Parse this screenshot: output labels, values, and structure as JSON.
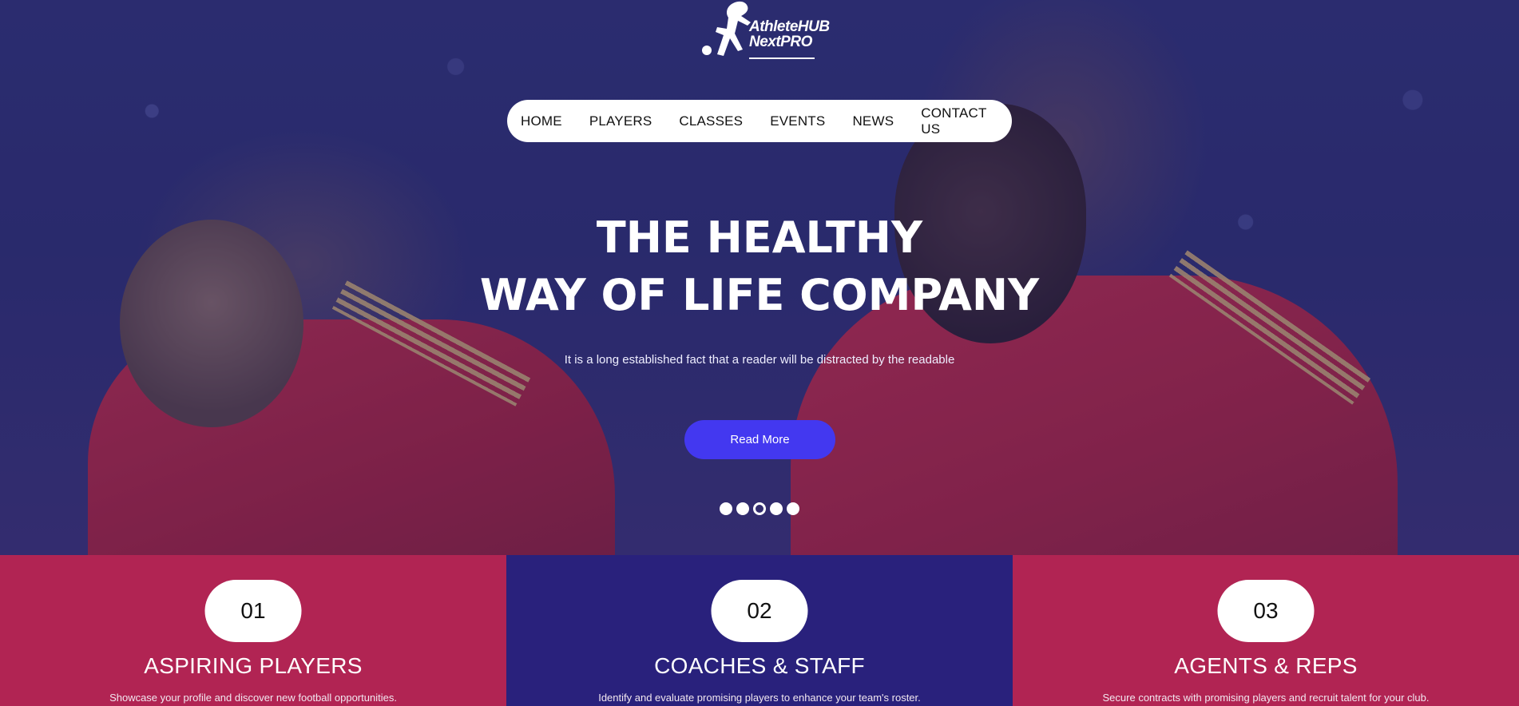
{
  "brand": {
    "line1": "AthleteHUB",
    "line2": "NextPRO"
  },
  "nav": {
    "items": [
      "HOME",
      "PLAYERS",
      "CLASSES",
      "EVENTS",
      "NEWS",
      "CONTACT US"
    ]
  },
  "hero": {
    "title_line1": "THE HEALTHY",
    "title_line2": "WAY OF LIFE COMPANY",
    "subtitle": "It is a long established fact that a reader will be distracted by the readable",
    "cta_label": "Read More",
    "slides_total": 5,
    "active_slide": 3
  },
  "cards": [
    {
      "number": "01",
      "title": "ASPIRING PLAYERS",
      "description": "Showcase your profile and discover new football opportunities.",
      "color": "#b12453"
    },
    {
      "number": "02",
      "title": "COACHES & STAFF",
      "description": "Identify and evaluate promising players to enhance your team's roster.",
      "color": "#29217c"
    },
    {
      "number": "03",
      "title": "AGENTS & REPS",
      "description": "Secure contracts with promising players and recruit talent for your club.",
      "color": "#b12453"
    }
  ],
  "colors": {
    "accent": "#4338f0",
    "pink": "#b12453",
    "navy": "#29217c"
  }
}
